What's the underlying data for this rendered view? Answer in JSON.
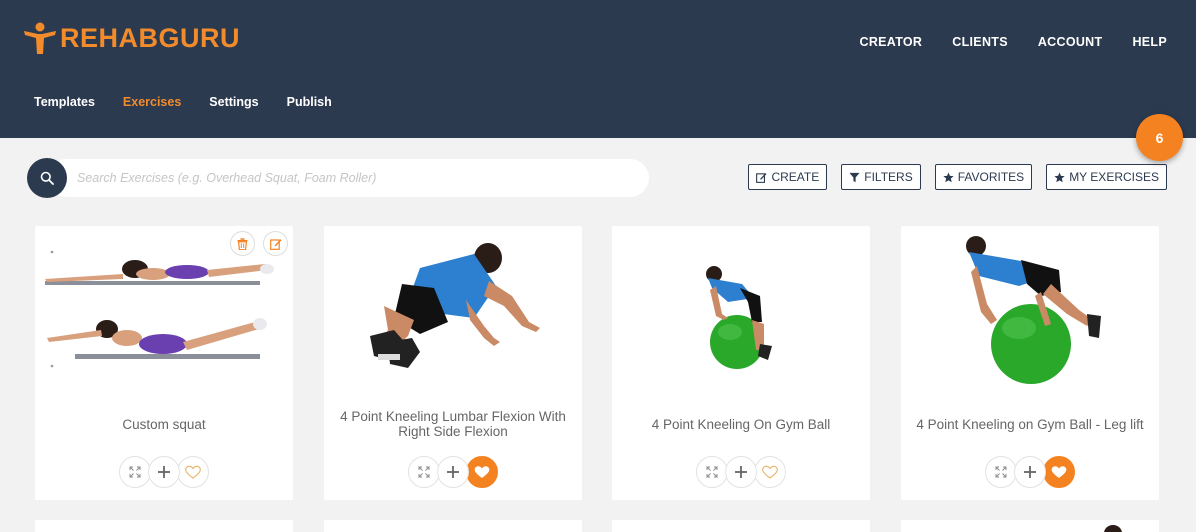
{
  "brand": {
    "name": "REHABGURU",
    "accent": "#f28b2b",
    "header_bg": "#2c3a50"
  },
  "topnav": [
    {
      "label": "CREATOR"
    },
    {
      "label": "CLIENTS"
    },
    {
      "label": "ACCOUNT"
    },
    {
      "label": "HELP"
    }
  ],
  "subnav": [
    {
      "label": "Templates",
      "active": false
    },
    {
      "label": "Exercises",
      "active": true
    },
    {
      "label": "Settings",
      "active": false
    },
    {
      "label": "Publish",
      "active": false
    }
  ],
  "badge": {
    "count": "6"
  },
  "search": {
    "placeholder": "Search Exercises (e.g. Overhead Squat, Foam Roller)",
    "icon": "search-icon"
  },
  "actions": [
    {
      "label": "CREATE",
      "icon": "edit-icon"
    },
    {
      "label": "FILTERS",
      "icon": "filter-icon"
    },
    {
      "label": "FAVORITES",
      "icon": "star-icon"
    },
    {
      "label": "MY EXERCISES",
      "icon": "star-icon"
    }
  ],
  "exercises": [
    {
      "title": "Custom squat",
      "favorited": false,
      "custom": true,
      "image": "superman-prone-lift-photo"
    },
    {
      "title": "4 Point Kneeling Lumbar Flexion With Right Side Flexion",
      "favorited": true,
      "custom": false,
      "image": "kneeling-flexion-photo"
    },
    {
      "title": "4 Point Kneeling On Gym Ball",
      "favorited": false,
      "custom": false,
      "image": "gym-ball-kneeling-photo"
    },
    {
      "title": "4 Point Kneeling on Gym Ball - Leg lift",
      "favorited": true,
      "custom": false,
      "image": "gym-ball-leg-lift-photo"
    }
  ]
}
